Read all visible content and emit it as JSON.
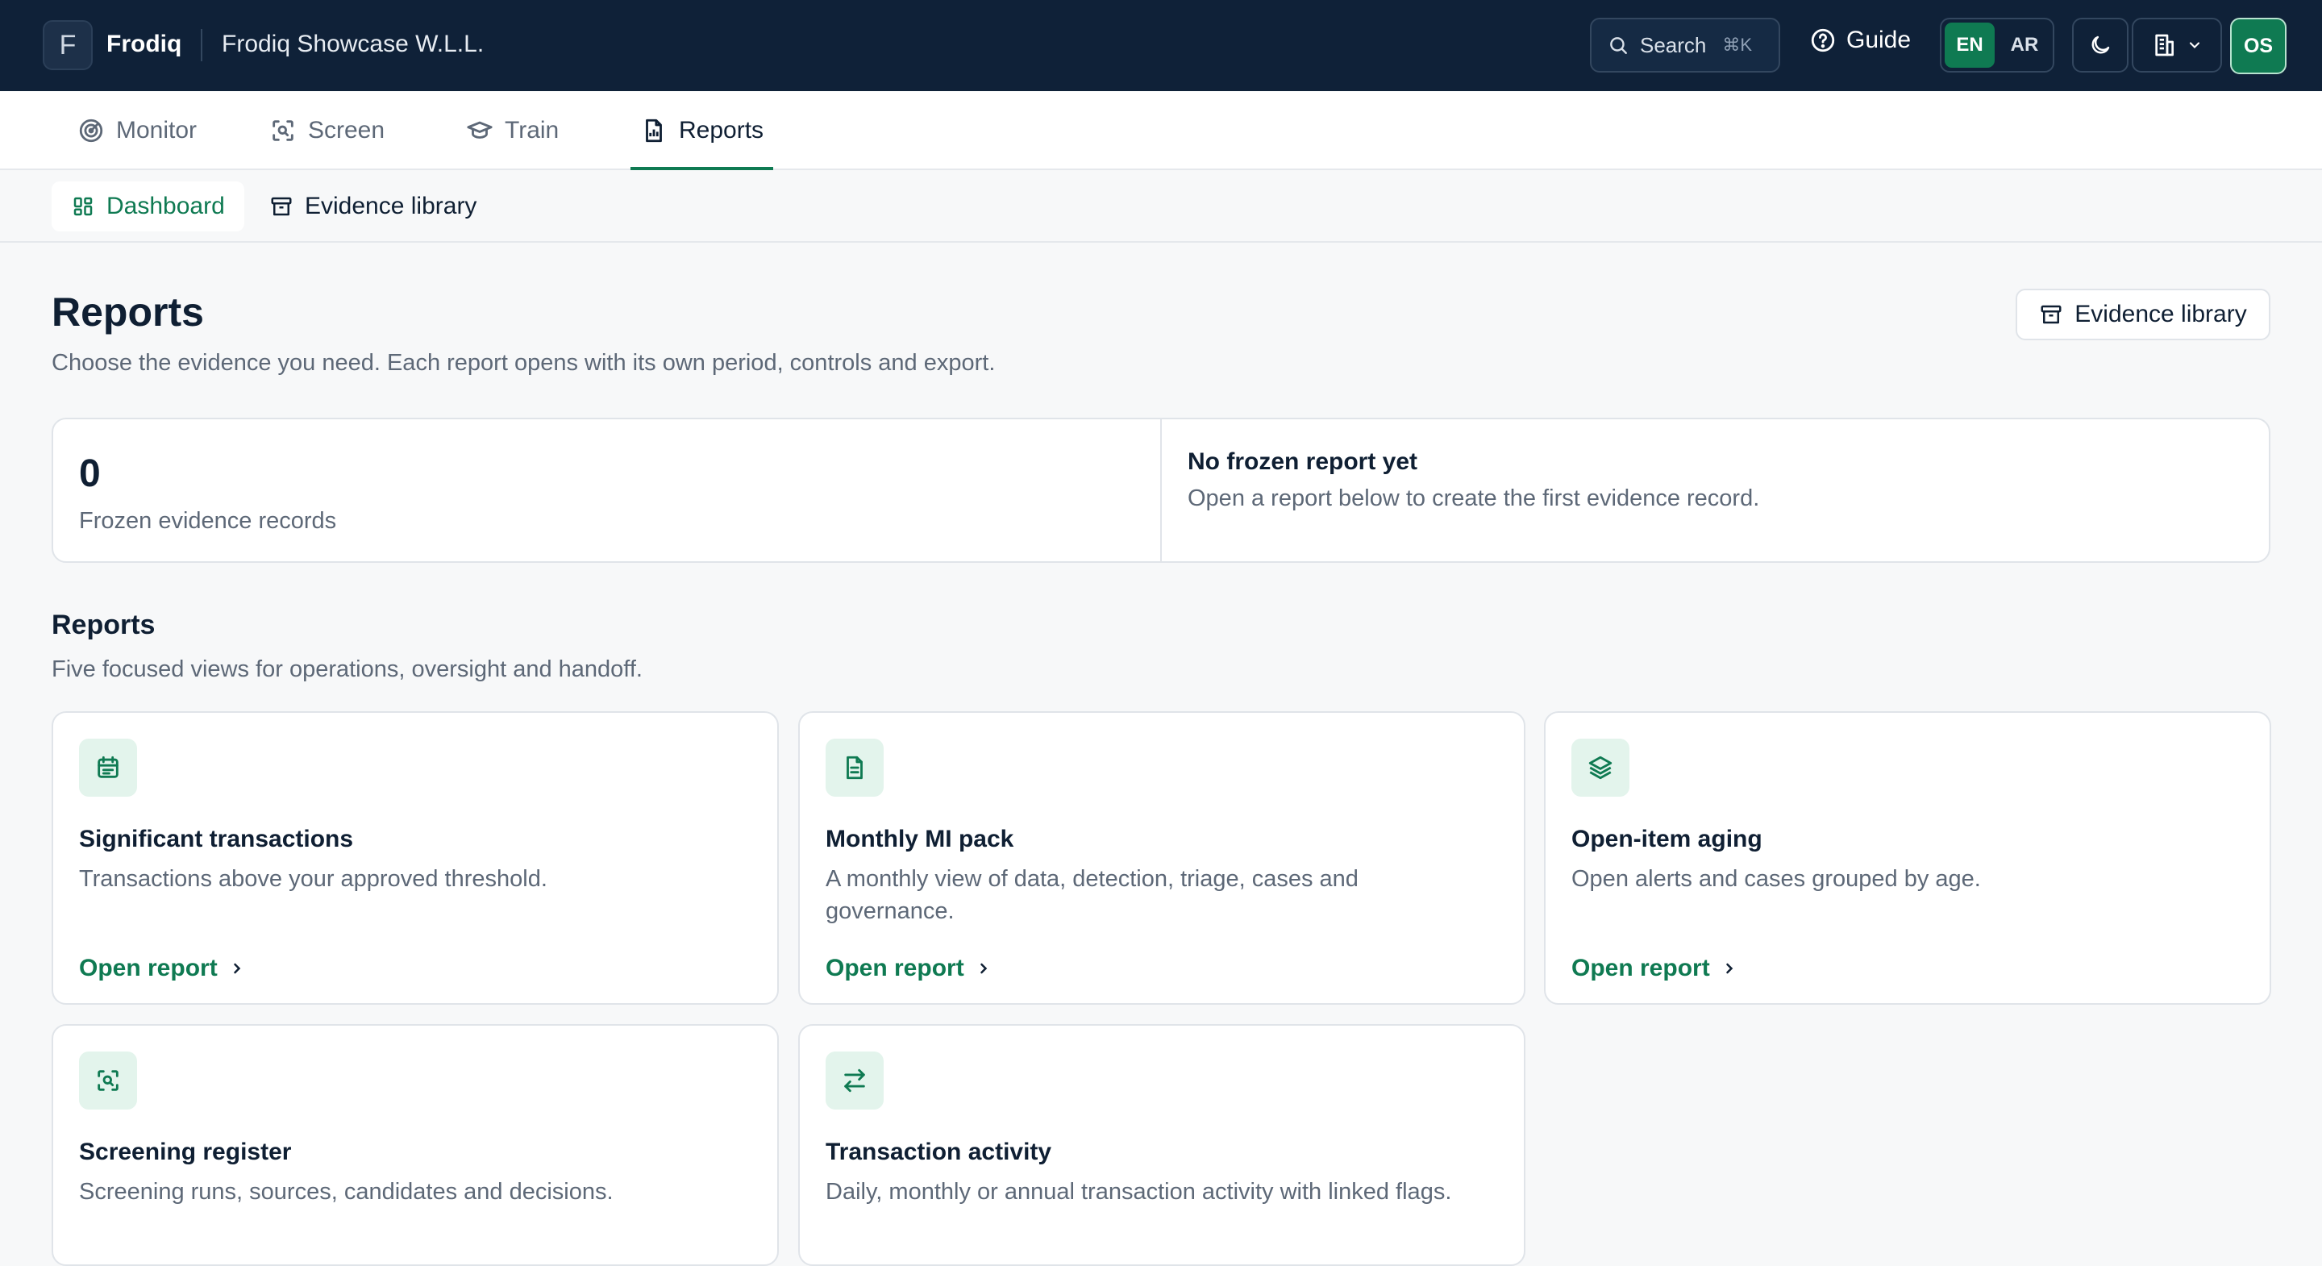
{
  "header": {
    "logo_letter": "F",
    "brand": "Frodiq",
    "org_name": "Frodiq Showcase W.L.L.",
    "search_label": "Search",
    "search_shortcut": "⌘K",
    "guide_label": "Guide",
    "languages": [
      "EN",
      "AR"
    ],
    "active_language": "EN",
    "avatar_initials": "OS",
    "icons": [
      "search-icon",
      "help-circle-icon",
      "moon-icon",
      "building-icon",
      "chevron-down-icon"
    ]
  },
  "primary_nav": {
    "items": [
      {
        "label": "Monitor",
        "icon": "radar-icon"
      },
      {
        "label": "Screen",
        "icon": "scan-icon"
      },
      {
        "label": "Train",
        "icon": "graduation-cap-icon"
      },
      {
        "label": "Reports",
        "icon": "report-chart-icon"
      }
    ],
    "active": "Reports"
  },
  "secondary_nav": {
    "items": [
      {
        "label": "Dashboard",
        "icon": "dashboard-icon"
      },
      {
        "label": "Evidence library",
        "icon": "archive-icon"
      }
    ],
    "active": "Dashboard"
  },
  "page": {
    "title": "Reports",
    "subtitle": "Choose the evidence you need. Each report opens with its own period, controls and export.",
    "evidence_library_button": "Evidence library"
  },
  "stats": {
    "frozen_count": "0",
    "frozen_label": "Frozen evidence records",
    "empty_title": "No frozen report yet",
    "empty_desc": "Open a report below to create the first evidence record."
  },
  "reports_section": {
    "title": "Reports",
    "subtitle": "Five focused views for operations, oversight and handoff.",
    "cards": [
      {
        "title": "Significant transactions",
        "desc": "Transactions above your approved threshold.",
        "link": "Open report",
        "icon": "calendar-list-icon"
      },
      {
        "title": "Monthly MI pack",
        "desc": "A monthly view of data, detection, triage, cases and governance.",
        "link": "Open report",
        "icon": "document-icon"
      },
      {
        "title": "Open-item aging",
        "desc": "Open alerts and cases grouped by age.",
        "link": "Open report",
        "icon": "layers-icon"
      },
      {
        "title": "Screening register",
        "desc": "Screening runs, sources, candidates and decisions.",
        "link": "Open report",
        "icon": "scan-icon"
      },
      {
        "title": "Transaction activity",
        "desc": "Daily, monthly or annual transaction activity with linked flags.",
        "link": "Open report",
        "icon": "arrows-swap-icon"
      }
    ]
  },
  "colors": {
    "header_bg": "#0f2138",
    "accent": "#0f7a52",
    "icon_tile_bg": "#e3f4ec",
    "page_bg": "#f7f8f9"
  }
}
